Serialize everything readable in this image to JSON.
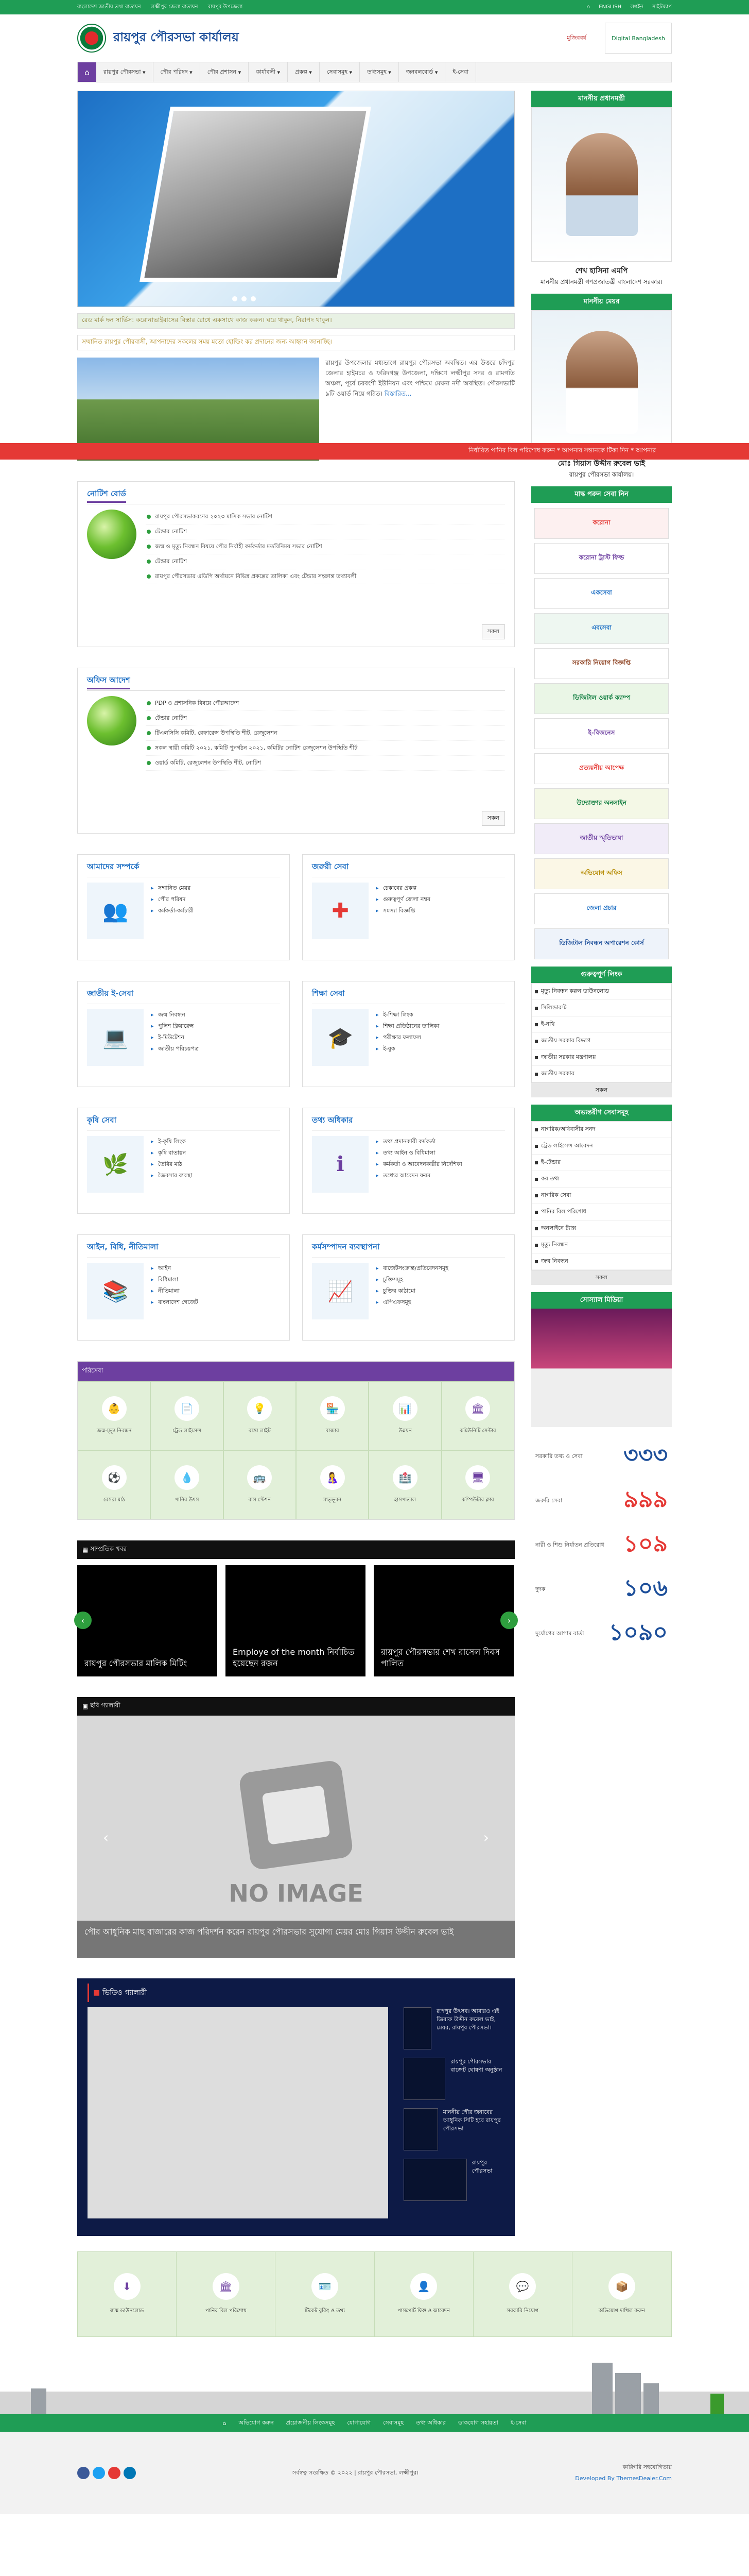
{
  "topbar": {
    "links": [
      "বাংলাদেশ জাতীয় তথ্য বাতায়ন",
      "লক্ষ্মীপুর জেলা বাতায়ন",
      "রায়পুর উপজেলা"
    ],
    "right": [
      "⌂",
      "ENGLISH",
      "লগইন",
      "সাইটম্যাপ"
    ]
  },
  "header": {
    "title": "রায়পুর পৌরসভা কার্যালয়",
    "mujib_text": "মুজিববর্ষ",
    "bd_logo_text": "Digital Bangladesh"
  },
  "nav": {
    "items": [
      "রায়পুর পৌরসভা",
      "পৌর পরিষদ",
      "পৌর প্রশাসন",
      "কার্যাবলী",
      "প্রকল্প",
      "সেবাসমূহ",
      "তথ্যসমূহ",
      "জনবলবোর্ড",
      "ই-সেবা"
    ]
  },
  "ticker": {
    "text1": "রেড মার্ক দল সার্ভিস: করোনাভাইরাসের বিস্তার রোধে একসাথে কাজ করুন। ঘরে থাকুন, নিরাপদ থাকুন।",
    "text2": "সম্মানিত রায়পুর পৌরবাসী, আপনাদের সকলের সময় মতো হোল্ডিং কর প্রদানের জন্য আহ্বান জানাচ্ছি।"
  },
  "red_marquee": "নির্ধারিত পানির বিল পরিশোধ করুন * আপনার সন্তানকে টিকা দিন * আপনার",
  "about": {
    "text": "রায়পুর উপজেলার মধ্যভাগে রায়পুর পৌরসভা অবস্থিত। এর উত্তরে চাঁদপুর জেলার হাইমচর ও ফরিদগঞ্জ উপজেলা, দক্ষিণে লক্ষ্মীপুর সদর ও রামগতি অঞ্চল, পূর্বে চরবংশী ইউনিয়ন এবং পশ্চিমে মেঘনা নদী অবস্থিত। পৌরসভাটি ৯টি ওয়ার্ড নিয়ে গঠিত।",
    "more": "বিস্তারিত..."
  },
  "notice_board": {
    "title": "নোটিশ বোর্ড",
    "items": [
      "রায়পুর পৌরসভাকরণের ২০২৩ মাসিক সভার নোটিশ",
      "টেন্ডার নোটিশ",
      "জন্ম ও মৃত্যু নিবন্ধন বিষয়ে পৌর নির্বাহী কর্মকর্তার মতবিনিময় সভার নোটিশ",
      "টেন্ডার নোটিশ",
      "রায়পুর পৌরসভার এডিপি অর্থায়নে বিভিন্ন প্রকল্পের তালিকা এবং টেন্ডার সংক্রান্ত তথ্যাবলী"
    ],
    "all": "সকল"
  },
  "office_order": {
    "title": "অফিস আদেশ",
    "items": [
      "PDP ও প্রশাসনিক বিষয়ে পৌরআদেশ",
      "টেন্ডার নোটিশ",
      "টিএলসিসি কমিটি, রেফারেন্স উপস্থিতি শীট, রেজুলেশন",
      "সকল স্থায়ী কমিটি ২০২১, কমিটি পুনর্গঠন ২০২১, কমিটির নোটিশ রেজুলেশন উপস্থিতি শীট",
      "ওয়ার্ড কমিটি, রেজুলেশন উপস্থিতি শীট, নোটিশ"
    ],
    "all": "সকল"
  },
  "cards": [
    {
      "title": "আমাদের সম্পর্কে",
      "items": [
        "সম্মানিত মেয়র",
        "পৌর পরিষদ",
        "কর্মকর্তা-কর্মচারী"
      ]
    },
    {
      "title": "জরুরী সেবা",
      "items": [
        "চেকাবের প্রকল্প",
        "গুরুত্বপূর্ণ জেলা নম্বর",
        "সমস্যা বিজ্ঞপ্তি"
      ]
    },
    {
      "title": "জাতীয় ই-সেবা",
      "items": [
        "জন্ম নিবন্ধন",
        "পুলিশ ক্লিয়ারেন্স",
        "ই-মিউটেশন",
        "জাতীয় পরিচয়পত্র"
      ]
    },
    {
      "title": "শিক্ষা সেবা",
      "items": [
        "ই-শিক্ষা লিংক",
        "শিক্ষা প্রতিষ্ঠানের তালিকা",
        "পরীক্ষার ফলাফল",
        "ই-বুক"
      ]
    },
    {
      "title": "কৃষি সেবা",
      "items": [
        "ই-কৃষি লিংক",
        "কৃষি বাতায়ন",
        "তৈরির মাঠ",
        "জৈবসার ব্যবস্থা"
      ]
    },
    {
      "title": "তথ্য অধিকার",
      "items": [
        "তথ্য প্রদানকারী কর্মকর্তা",
        "তথ্য আইন ও বিধিমালা",
        "কর্মকর্তা ও আবেদনকারীর নির্দেশিকা",
        "তথ্যের আবেদন ফরম"
      ]
    },
    {
      "title": "আইন, বিধি, নীতিমালা",
      "items": [
        "আইন",
        "বিধিমালা",
        "নীতিমালা",
        "বাংলাদেশ গেজেট"
      ]
    },
    {
      "title": "কর্মসম্পাদন ব্যবস্থাপনা",
      "items": [
        "বাজেটসংক্রান্ত/প্রতিবেদনসমূহ",
        "চুক্তিসমূহ",
        "চুক্তির কাঠামো",
        "এপিএফসমূহ"
      ]
    }
  ],
  "portal": {
    "title": "পরিসেবা",
    "items": [
      "জন্ম-মৃত্যু নিবন্ধন",
      "ট্রেড লাইসেন্স",
      "রাস্তা লাইট",
      "বাজার",
      "উন্নয়ন",
      "কমিউনিটি সেন্টার",
      "বেসরা মাঠ",
      "পানির উৎস",
      "বাস স্টেশন",
      "মাতৃভূবন",
      "হাসপাতাল",
      "কম্পিউটার ক্লাব"
    ]
  },
  "news": {
    "title": "সাম্প্রতিক খবর",
    "items": [
      "রায়পুর পৌরসভার মালিক মিটিং",
      "Employe of the month নির্বাচিত হয়েছেন রজন",
      "রায়পুর পৌরসভার শেখ রাসেল দিবস পালিত"
    ]
  },
  "gallery": {
    "title": "ছবি গ্যালারী",
    "noimg": "NO IMAGE",
    "caption": "পৌর আধুনিক মাছ বাজারের কাজ পরিদর্শন করেন রায়পুর পৌরসভার সুযোগ্য মেয়র মোঃ গিয়াস উদ্দীন রুবেল ভাই"
  },
  "video": {
    "title": "ভিডিও গ্যালারী",
    "items": [
      "রূপপুর উৎসব। আবারও এই জিরাফ উদ্দীন রুবেল ভাই, মেয়র, রায়পুর পৌরসভা।",
      "রায়পুর পৌরসভার বাজেট ঘোষণা অনুষ্ঠান",
      "মাননীয় পৌর জনাবের আধুনিক সিটি হবে রায়পুর পৌরসভা",
      "রায়পুর পৌরসভা"
    ]
  },
  "services": [
    "জন্ম ডাউনলোড",
    "পানির বিল পরিশোধ",
    "টিকেট বুকিং ও তথ্য",
    "পাসপোর্ট ফিঙ্গ ও আবেদন",
    "সরকারি নিয়োগ",
    "অভিযোগ দাখিল করুন"
  ],
  "sidebar": {
    "pm_head": "মাননীয় প্রধানমন্ত্রী",
    "pm_name": "শেখ হাসিনা এমপি",
    "pm_sub": "মাননীয় প্রধানমন্ত্রী গণপ্রজাতন্ত্রী বাংলাদেশ সরকার।",
    "mayor_head": "মাননীয় মেয়র",
    "mayor_name": "মোঃ গিয়াস উদ্দীন রুবেল ভাই",
    "mayor_sub": "রায়পুর পৌরসভা কার্যালয়।",
    "links_head": "মাস্ক পরুন সেবা নিন",
    "banners": [
      "করোনা",
      "করোনা ট্রাস্ট ফিল্ড",
      "একসেবা",
      "এবসেবা",
      "সরকারি নিয়োগ বিজ্ঞপ্তি",
      "ডিজিটাল ওয়ার্ক ক্যাম্প",
      "ই-বিজনেস",
      "প্রত্যয়নীয় আপেক্ষ",
      "উদ্যোক্তার অনলাইন",
      "জাতীয় স্মৃতিভাষা",
      "অভিযোগ অফিস",
      "জেলা প্রচার",
      "ডিজিটাল নিবন্ধন অপারেশন কোর্স"
    ],
    "important_head": "গুরুত্বপূর্ণ লিংক",
    "important": [
      "মৃত্যু নিবন্ধন করুন ডাউনলোড",
      "সিলিন্ডারস্ট",
      "ই-নথি",
      "জাতীয় সরকার বিভাগ",
      "জাতীয় সরকার মন্ত্রণালয়",
      "জাতীয় সরকার"
    ],
    "important_all": "সকল",
    "internal_head": "অভ্যন্তরীণ সেবাসমূহ",
    "internal": [
      "নাগরিক/অধিবাসীর সনদ",
      "ট্রেড লাইসেন্স আবেদন",
      "ই-টেন্ডার",
      "কর তথ্য",
      "নাগরিক সেবা",
      "পানির বিল পরিশোধ",
      "অনলাইনে ট্যাক্স",
      "মৃত্যু নিবন্ধন",
      "জন্ম নিবন্ধন"
    ],
    "internal_all": "সকল",
    "social_head": "সোস্যাল মিডিয়া",
    "hotlines": [
      {
        "label": "সরকারি তথ্য ও সেবা",
        "num": "৩৩৩"
      },
      {
        "label": "জরুরি সেবা",
        "num": "৯৯৯"
      },
      {
        "label": "নারী ও শিশু নির্যাতন প্রতিরোধ",
        "num": "১০৯"
      },
      {
        "label": "দুদক",
        "num": "১০৬"
      },
      {
        "label": "দুর্যোগের আগাম বার্তা",
        "num": "১০৯০"
      }
    ]
  },
  "footer": {
    "nav": [
      "⌂",
      "অভিযোগ করুন",
      "প্রয়োজনীয় লিংকসমূহ",
      "যোগাযোগ",
      "সেবাসমূহ",
      "তথ্য অধিকার",
      "ডাকযোগ সহায়তা",
      "ই-সেবা"
    ],
    "copyright": "সর্বস্বত্ব সংরক্ষিত © ২০২২ | রায়পুর পৌরসভা, লক্ষ্মীপুর।",
    "tech": "কারিগরি সহযোগিতায়",
    "dev": "Developed By ThemesDealer.Com"
  }
}
